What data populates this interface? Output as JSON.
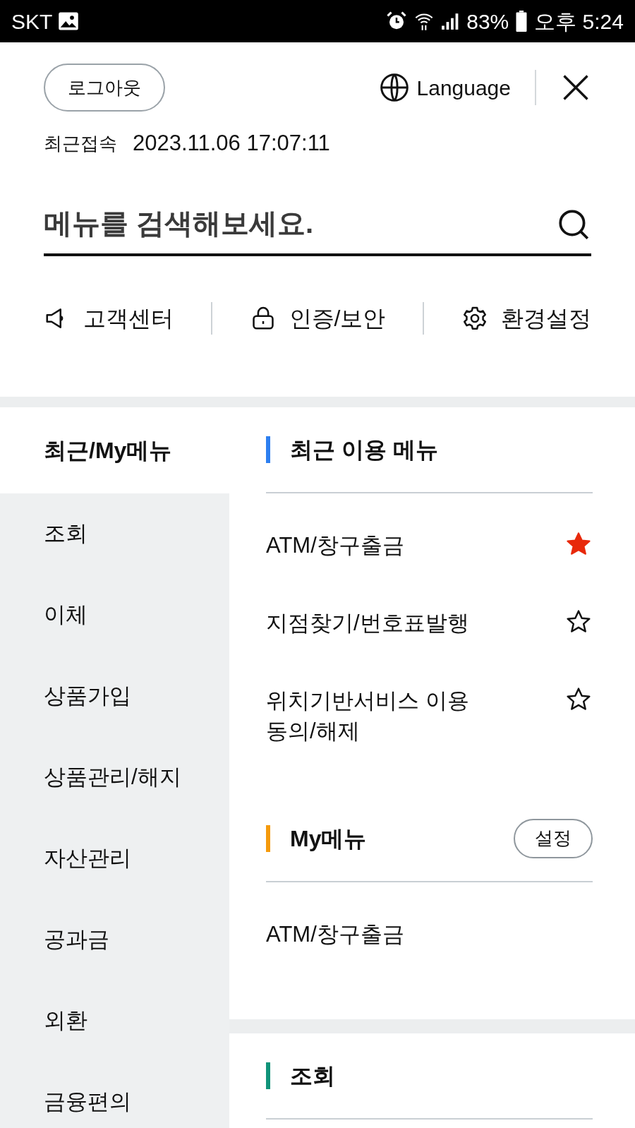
{
  "status_bar": {
    "carrier": "SKT",
    "battery": "83%",
    "time": "오후 5:24"
  },
  "header": {
    "logout_button": "로그아웃",
    "language_button": "Language",
    "last_access_label": "최근접속",
    "last_access_time": "2023.11.06 17:07:11"
  },
  "search": {
    "placeholder": "메뉴를 검색해보세요."
  },
  "quick_links": [
    {
      "label": "고객센터",
      "kind": "speaker"
    },
    {
      "label": "인증/보안",
      "kind": "lock"
    },
    {
      "label": "환경설정",
      "kind": "gear"
    }
  ],
  "sidebar": {
    "items": [
      {
        "label": "최근/My메뉴",
        "selected": true
      },
      {
        "label": "조회",
        "selected": false
      },
      {
        "label": "이체",
        "selected": false
      },
      {
        "label": "상품가입",
        "selected": false
      },
      {
        "label": "상품관리/해지",
        "selected": false
      },
      {
        "label": "자산관리",
        "selected": false
      },
      {
        "label": "공과금",
        "selected": false
      },
      {
        "label": "외환",
        "selected": false
      },
      {
        "label": "금융편의",
        "selected": false
      }
    ]
  },
  "panels": [
    {
      "sections": [
        {
          "title": "최근 이용 메뉴",
          "color": "#2d7ff0",
          "items": [
            {
              "label": "ATM/창구출금",
              "favorite": true
            },
            {
              "label": "지점찾기/번호표발행",
              "favorite": false
            },
            {
              "label": "위치기반서비스 이용 동의/해제",
              "favorite": false
            }
          ]
        },
        {
          "title": "My메뉴",
          "color": "#f59a0c",
          "button": "설정",
          "items": [
            {
              "label": "ATM/창구출금"
            }
          ]
        }
      ]
    },
    {
      "sections": [
        {
          "title": "조회",
          "color": "#109379"
        }
      ]
    }
  ]
}
